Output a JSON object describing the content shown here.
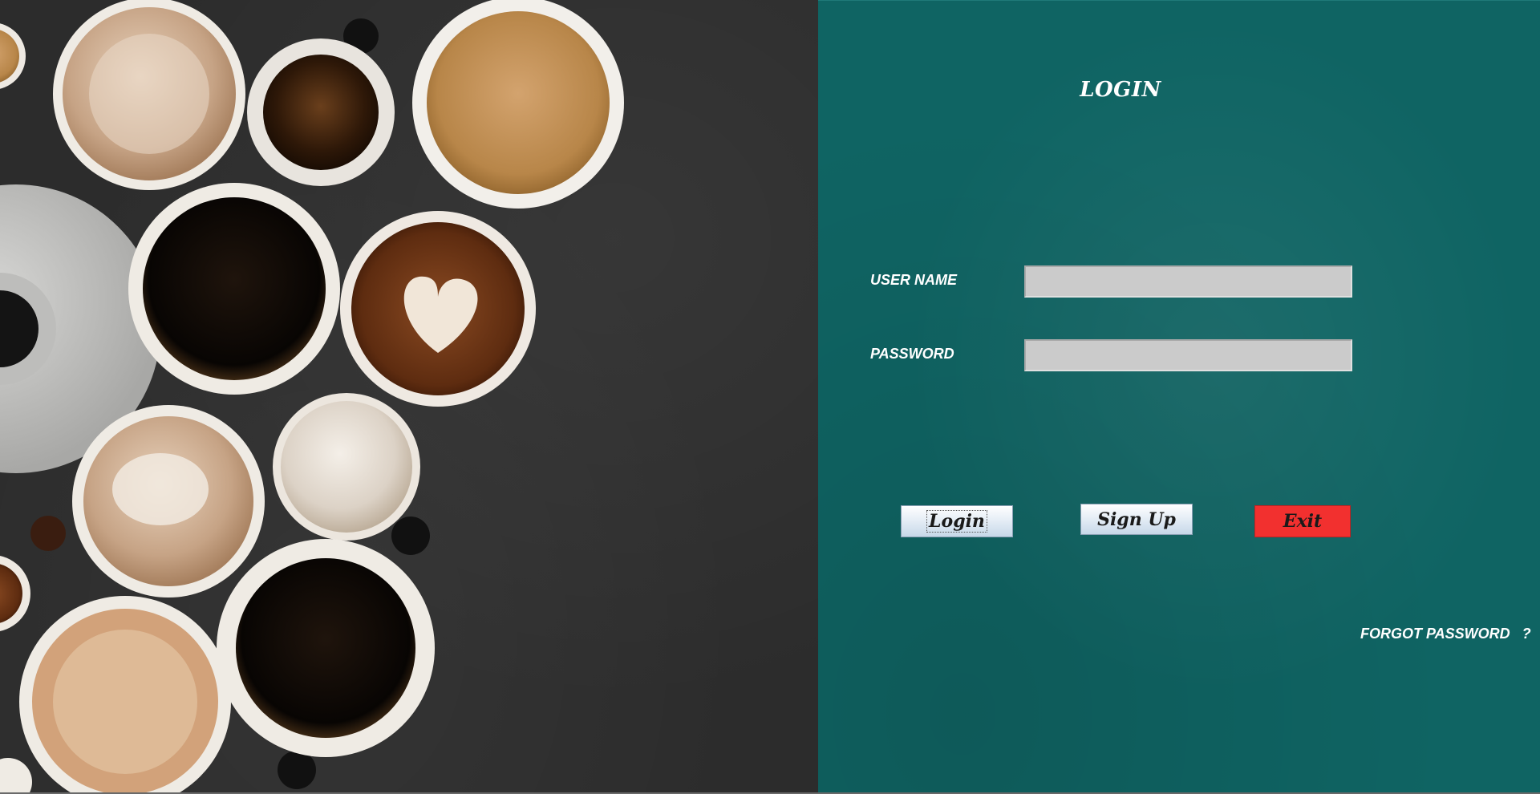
{
  "login_panel": {
    "title": "LOGIN",
    "username_label": "USER NAME",
    "password_label": "PASSWORD",
    "username_value": "",
    "password_value": "",
    "login_button": "Login",
    "signup_button": "Sign Up",
    "exit_button": "Exit",
    "forgot_password": "FORGOT PASSWORD   ?"
  },
  "colors": {
    "panel_background": "#0f6463",
    "image_background": "#2c2c2c",
    "exit_button": "#f2302f",
    "field_background": "#cbcbcb",
    "text": "#ffffff"
  },
  "decoration": {
    "left_image": "coffee-cups-photo"
  }
}
